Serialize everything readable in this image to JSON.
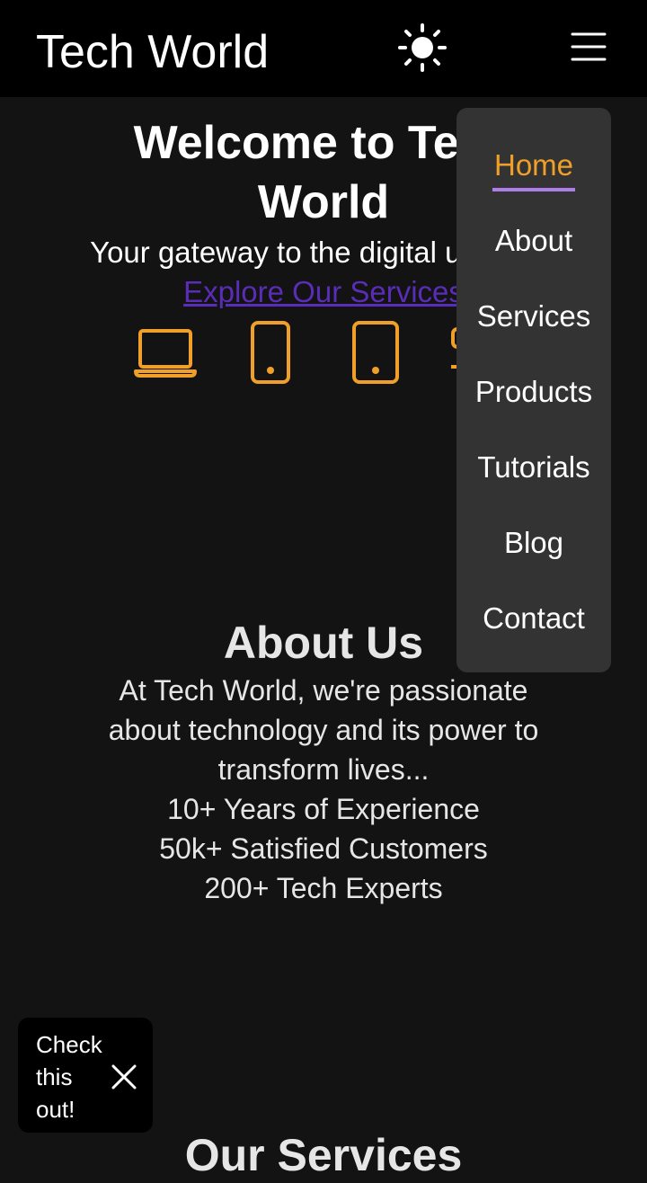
{
  "header": {
    "brand": "Tech World",
    "theme_toggle_icon": "sun-icon",
    "menu_icon": "hamburger-menu-icon"
  },
  "hero": {
    "title_line1": "Welcome to Tech",
    "title_line2": "World",
    "subtitle": "Your gateway to the digital universe",
    "cta_link": "Explore Our Services",
    "icons": [
      "laptop-icon",
      "smartphone-icon",
      "tablet-icon",
      "server-icon"
    ]
  },
  "about": {
    "title": "About Us",
    "text": "At Tech World, we're passionate about technology and its power to transform lives...",
    "stats": [
      "10+ Years of Experience",
      "50k+ Satisfied Customers",
      "200+ Tech Experts"
    ]
  },
  "services": {
    "title": "Our Services"
  },
  "nav": {
    "items": [
      {
        "label": "Home",
        "active": true
      },
      {
        "label": "About",
        "active": false
      },
      {
        "label": "Services",
        "active": false
      },
      {
        "label": "Products",
        "active": false
      },
      {
        "label": "Tutorials",
        "active": false
      },
      {
        "label": "Blog",
        "active": false
      },
      {
        "label": "Contact",
        "active": false
      }
    ]
  },
  "toast": {
    "text": "Check this out!",
    "close_icon": "close-icon"
  },
  "colors": {
    "header_bg": "#000000",
    "page_bg": "#131313",
    "accent": "#f0a028",
    "link": "#5a2db8",
    "menu_bg": "#333333",
    "active_underline": "#b07ee8"
  }
}
